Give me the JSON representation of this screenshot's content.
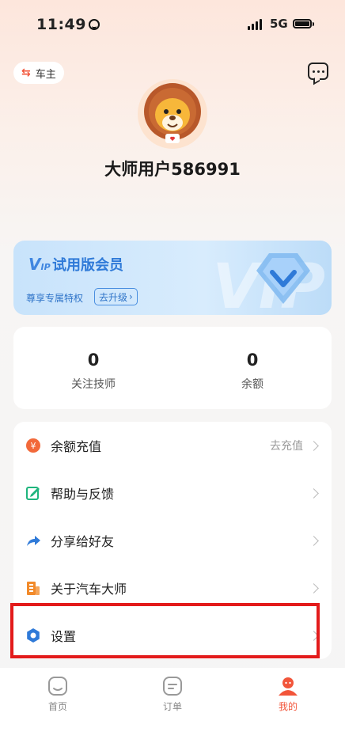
{
  "status_bar": {
    "time": "11:49",
    "network": "5G"
  },
  "header": {
    "role_label": "车主"
  },
  "profile": {
    "username": "大师用户586991"
  },
  "vip": {
    "logo": "VIP",
    "title": "试用版会员",
    "subtitle": "尊享专属特权",
    "upgrade_label": "去升级",
    "watermark": "VIP"
  },
  "stats": [
    {
      "value": "0",
      "label": "关注技师"
    },
    {
      "value": "0",
      "label": "余额"
    }
  ],
  "menu": [
    {
      "label": "余额充值",
      "action": "去充值",
      "icon": "coin-icon",
      "color": "#f2693a"
    },
    {
      "label": "帮助与反馈",
      "action": "",
      "icon": "feedback-edit-icon",
      "color": "#1fb57d"
    },
    {
      "label": "分享给好友",
      "action": "",
      "icon": "share-arrow-icon",
      "color": "#2f7ad8"
    },
    {
      "label": "关于汽车大师",
      "action": "",
      "icon": "building-icon",
      "color": "#f28a2a"
    },
    {
      "label": "设置",
      "action": "",
      "icon": "gear-icon",
      "color": "#2f7ad8"
    }
  ],
  "tabs": [
    {
      "label": "首页",
      "icon": "home-icon",
      "active": false
    },
    {
      "label": "订单",
      "icon": "order-icon",
      "active": false
    },
    {
      "label": "我的",
      "icon": "profile-icon",
      "active": true
    }
  ],
  "colors": {
    "accent": "#f2553a",
    "vip_blue": "#2f7ad8",
    "highlight": "#e31b1b"
  }
}
